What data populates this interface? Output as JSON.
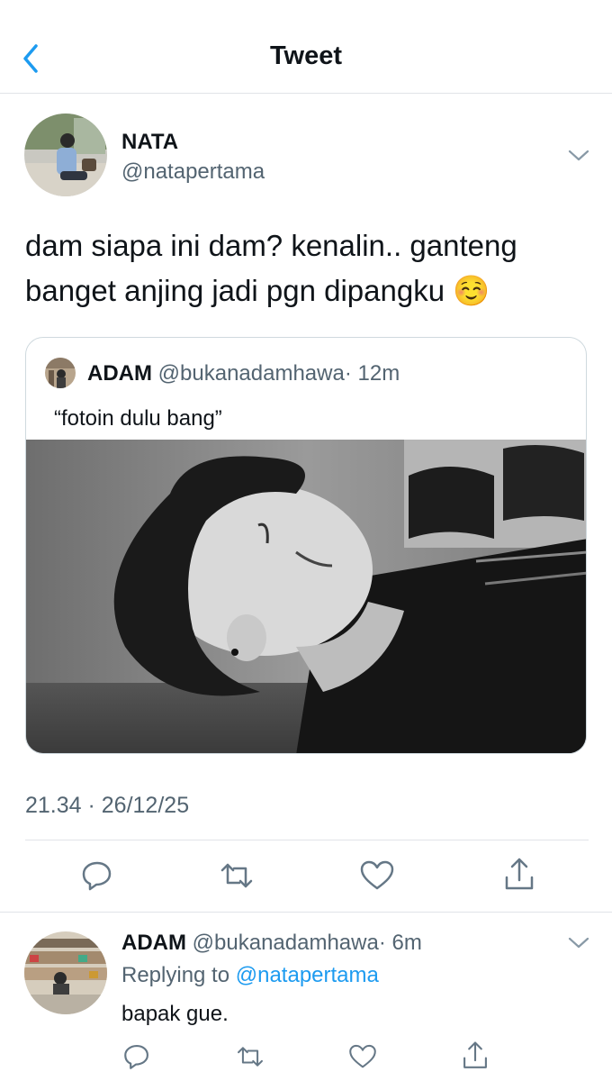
{
  "header": {
    "title": "Tweet"
  },
  "tweet": {
    "author_name": "NATA",
    "author_handle": "@natapertama",
    "text_line1": "dam siapa ini dam? kenalin.. ganteng",
    "text_line2": "banget anjing jadi pgn dipangku",
    "emoji": "☺️",
    "timestamp": "21.34 · 26/12/25",
    "quote": {
      "author_name": "ADAM",
      "author_handle": "@bukanadamhawa",
      "time": "· 12m",
      "text": "“fotoin dulu bang”"
    }
  },
  "reply": {
    "author_name": "ADAM",
    "author_handle": "@bukanadamhawa",
    "time": "· 6m",
    "replying_prefix": "Replying to",
    "replying_handle": "@natapertama",
    "text": "bapak gue."
  },
  "icons": [
    "back-chevron-icon",
    "more-chevron-icon",
    "reply-icon",
    "retweet-icon",
    "like-icon",
    "share-icon"
  ],
  "colors": {
    "link": "#1d9bf0",
    "secondary": "#536471"
  }
}
